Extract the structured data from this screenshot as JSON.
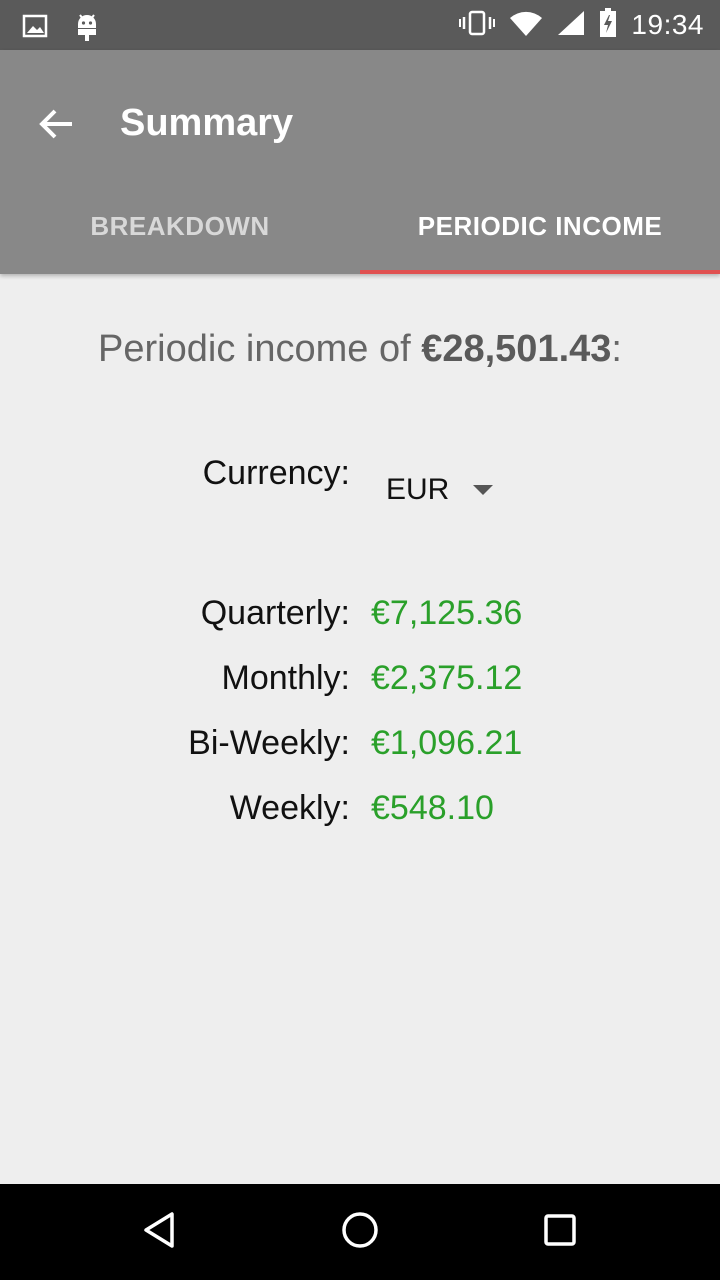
{
  "status_bar": {
    "time": "19:34",
    "icons": [
      "image-icon",
      "android-debug-icon",
      "vibrate-icon",
      "wifi-icon",
      "signal-icon",
      "battery-charging-icon"
    ]
  },
  "app_bar": {
    "title": "Summary",
    "back_icon": "arrow-back-icon",
    "color": "#888888"
  },
  "tabs": [
    {
      "label": "BREAKDOWN",
      "active": false
    },
    {
      "label": "PERIODIC INCOME",
      "active": true
    }
  ],
  "accent_color": "#e05050",
  "summary": {
    "prefix": "Periodic income of ",
    "total": "€28,501.43",
    "suffix": ":"
  },
  "currency": {
    "label": "Currency:",
    "selected": "EUR"
  },
  "amount_color": "#2aa02a",
  "periods": [
    {
      "label": "Quarterly:",
      "amount": "€7,125.36"
    },
    {
      "label": "Monthly:",
      "amount": "€2,375.12"
    },
    {
      "label": "Bi-Weekly:",
      "amount": "€1,096.21"
    },
    {
      "label": "Weekly:",
      "amount": "€548.10"
    }
  ],
  "nav_bar": {
    "icons": [
      "back-triangle-icon",
      "home-circle-icon",
      "recents-square-icon"
    ]
  }
}
